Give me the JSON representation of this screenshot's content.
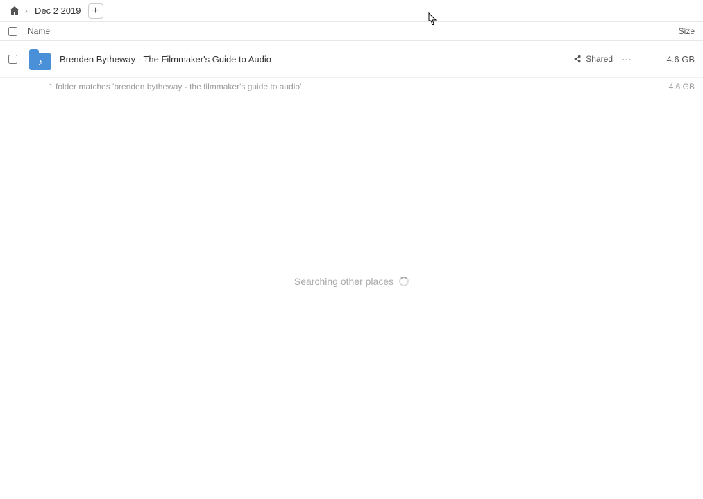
{
  "breadcrumb": {
    "home_label": "Home",
    "date_label": "Dec 2 2019",
    "add_label": "+"
  },
  "table": {
    "header": {
      "name_label": "Name",
      "size_label": "Size"
    }
  },
  "file_row": {
    "name": "Brenden Bytheway - The Filmmaker's Guide to Audio",
    "shared_label": "Shared",
    "more_label": "···",
    "size": "4.6 GB"
  },
  "match_info": {
    "text": "1 folder matches 'brenden bytheway - the filmmaker's guide to audio'",
    "size": "4.6 GB"
  },
  "searching": {
    "text": "Searching other places"
  }
}
